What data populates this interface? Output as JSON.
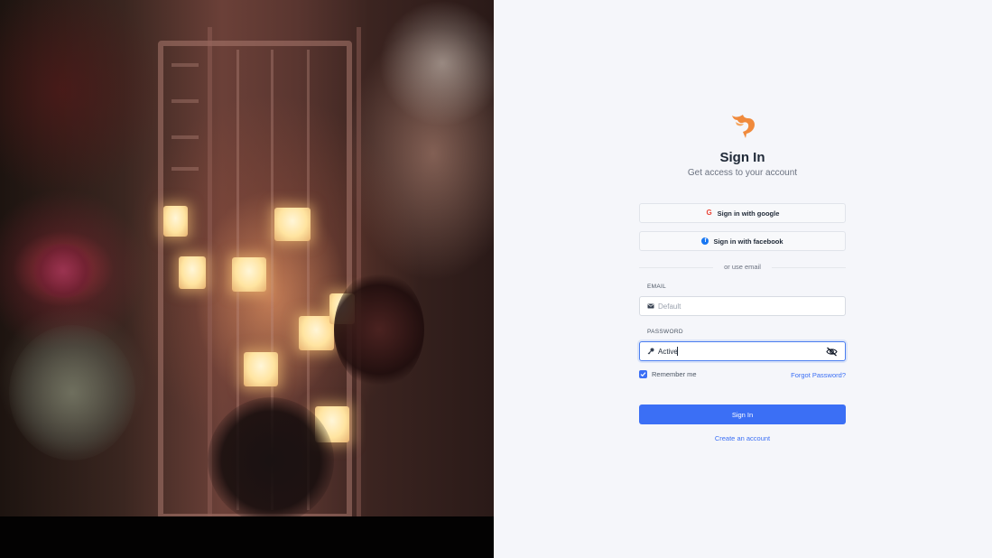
{
  "header": {
    "title": "Sign In",
    "subtitle": "Get access to your account",
    "logo_icon": "phoenix-logo-icon",
    "logo_color": "#f08a3c"
  },
  "social": {
    "google_label": "Sign in with google",
    "facebook_label": "Sign in with facebook"
  },
  "divider": {
    "text": "or use email"
  },
  "form": {
    "email_label": "EMAIL",
    "email_placeholder": "Default",
    "email_value": "",
    "password_label": "PASSWORD",
    "password_value": "Active",
    "remember_label": "Remember me",
    "remember_checked": true,
    "forgot_label": "Forgot Password?",
    "submit_label": "Sign In",
    "create_label": "Create an account"
  },
  "colors": {
    "accent": "#3b6ff5",
    "background": "#f5f6fa",
    "google": "#ea4335",
    "facebook": "#1877f2"
  }
}
